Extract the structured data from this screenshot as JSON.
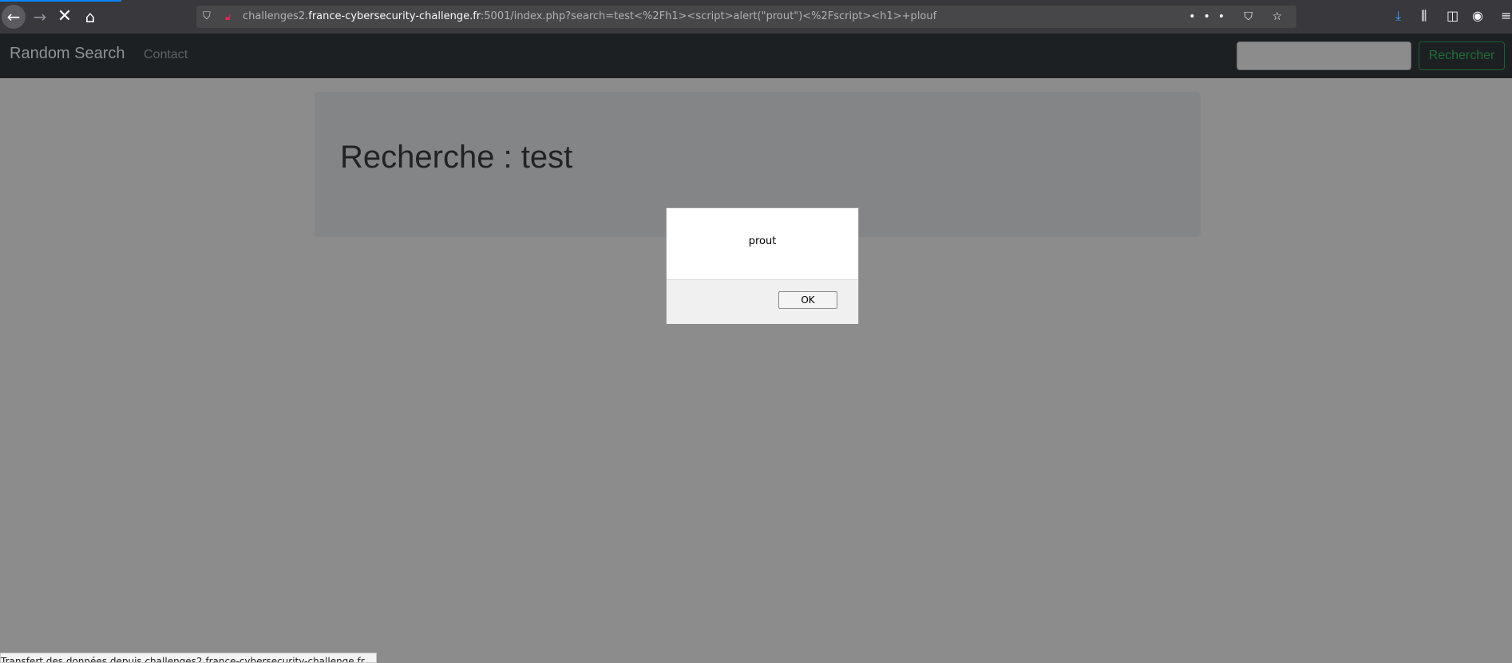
{
  "browser": {
    "url_prefix": "challenges2.",
    "url_host": "france-cybersecurity-challenge.fr",
    "url_rest": ":5001/index.php?search=test<%2Fh1><script>alert(\"prout\")<%2Fscript><h1>+plouf",
    "icons": {
      "back": "←",
      "forward": "→",
      "stop": "✕",
      "home": "⌂",
      "page_actions": "••• ⛉ ☆",
      "download": "⤓",
      "library": "⫼",
      "sidebar": "◫",
      "account": "◉",
      "menu": "≡"
    },
    "status_text": "Transfert des données depuis challenges2.france-cybersecurity-challenge.fr…"
  },
  "navbar": {
    "brand": "Random Search",
    "contact": "Contact",
    "search_placeholder": "",
    "search_button": "Rechercher"
  },
  "main": {
    "heading": "Recherche : test"
  },
  "dialog": {
    "message": "prout",
    "ok_label": "OK"
  }
}
